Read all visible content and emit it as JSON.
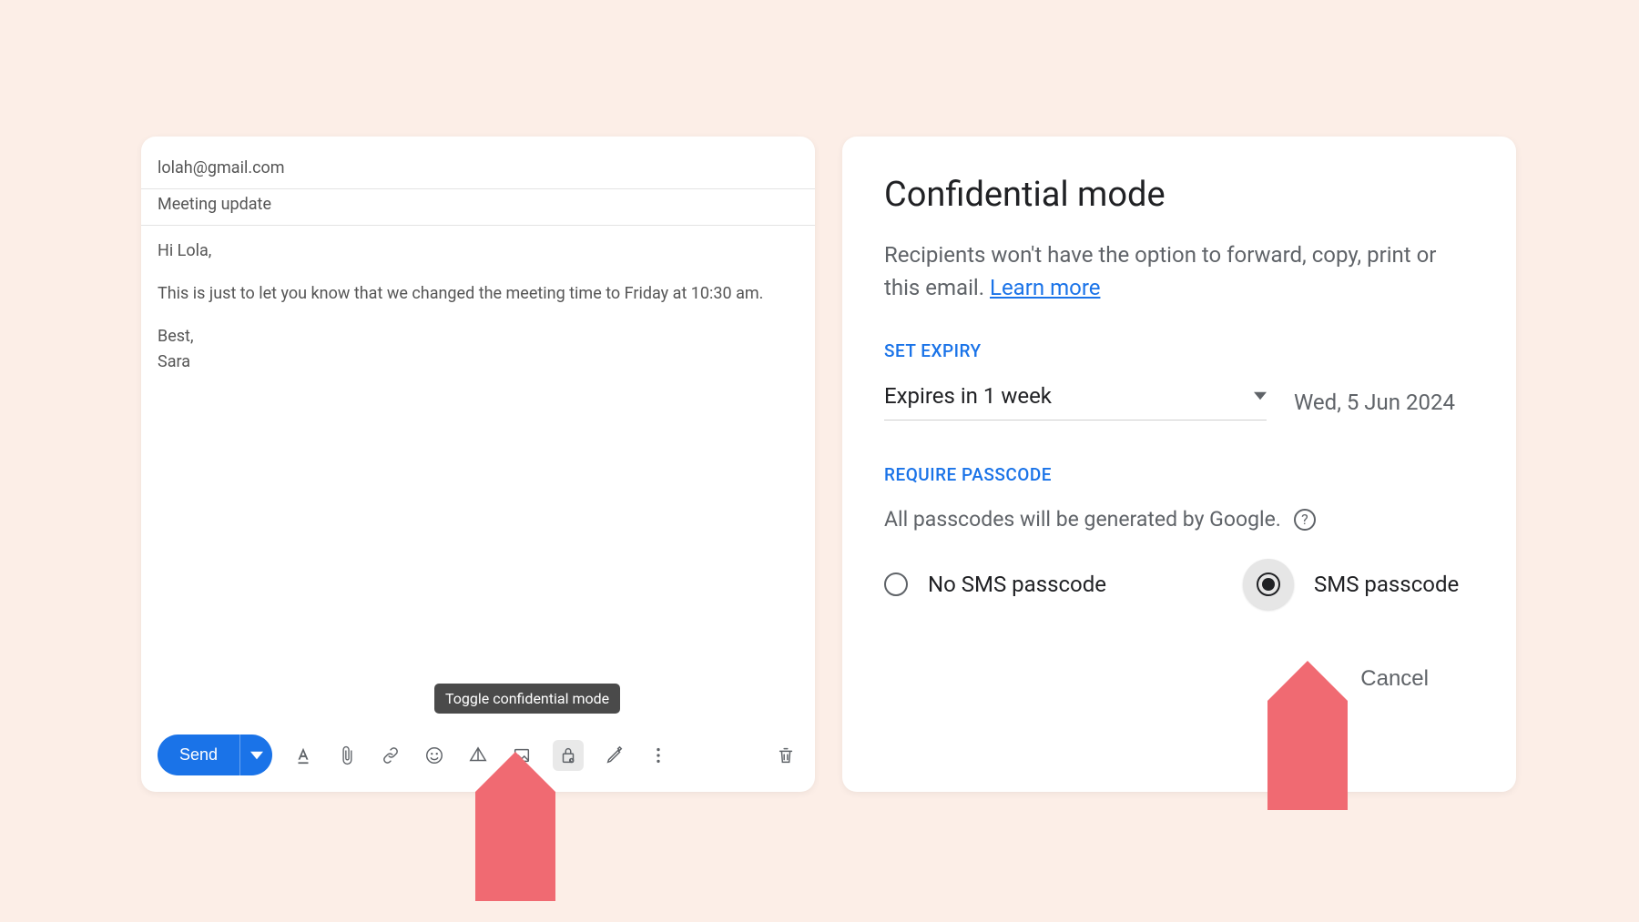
{
  "compose": {
    "to": "lolah@gmail.com",
    "subject": "Meeting update",
    "body_greeting": "Hi Lola,",
    "body_main": "This is just to let you know that we changed the meeting time to Friday at 10:30 am.",
    "body_sign1": "Best,",
    "body_sign2": "Sara",
    "send_label": "Send",
    "tooltip": "Toggle confidential mode"
  },
  "confidential": {
    "title": "Confidential mode",
    "description_prefix": "Recipients won't have the option to forward, copy, print or ",
    "description_suffix": "this email. ",
    "learn_more": "Learn more",
    "set_expiry_label": "SET EXPIRY",
    "expiry_value": "Expires in 1 week",
    "expiry_date": "Wed, 5 Jun 2024",
    "require_passcode_label": "REQUIRE PASSCODE",
    "passcode_note": "All passcodes will be generated by Google.",
    "no_sms_label": "No SMS passcode",
    "sms_label": "SMS passcode",
    "cancel_label": "Cancel"
  }
}
